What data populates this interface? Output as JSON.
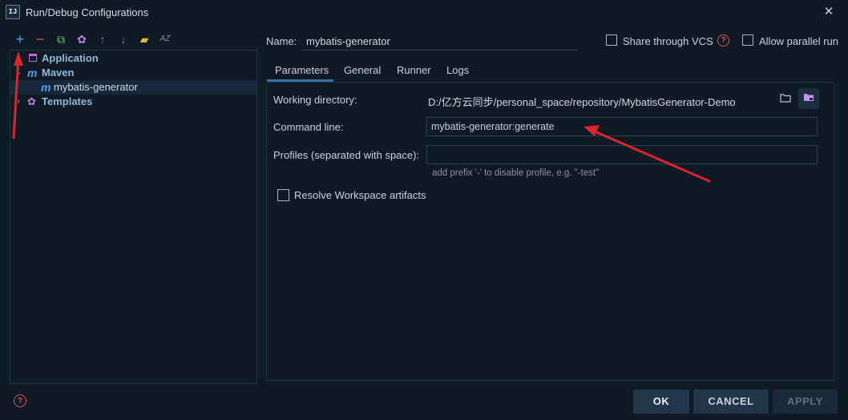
{
  "window": {
    "icon_text": "IJ",
    "title": "Run/Debug Configurations",
    "close_glyph": "✕"
  },
  "toolbar": {
    "icons": [
      "add-icon",
      "remove-icon",
      "copy-icon",
      "settings-icon",
      "move-up-icon",
      "move-down-icon",
      "new-folder-icon",
      "sort-alphabetically-icon"
    ],
    "add_glyph": "+",
    "remove_glyph": "−",
    "copy_glyph": "⧉",
    "settings_glyph": "✿",
    "up_glyph": "↑",
    "down_glyph": "↓",
    "folder_glyph": "▰",
    "sort_glyph": "AZ"
  },
  "tree": {
    "items": [
      {
        "label": "Application",
        "icon": "application-icon",
        "expanded": false
      },
      {
        "label": "Maven",
        "icon": "maven-icon",
        "expanded": true
      },
      {
        "label": "mybatis-generator",
        "icon": "maven-icon",
        "selected": true
      },
      {
        "label": "Templates",
        "icon": "wrench-icon",
        "expanded": false
      }
    ],
    "maven_glyph": "m"
  },
  "name_row": {
    "label": "Name:",
    "value": "mybatis-generator",
    "share_label": "Share through VCS",
    "share_checked": false,
    "help_glyph": "?",
    "parallel_label": "Allow parallel run",
    "parallel_checked": false
  },
  "tabs": [
    {
      "label": "Parameters",
      "active": true
    },
    {
      "label": "General"
    },
    {
      "label": "Runner"
    },
    {
      "label": "Logs"
    }
  ],
  "params": {
    "working_dir_label": "Working directory:",
    "working_dir_value": "D:/亿方云同步/personal_space/repository/MybatisGenerator-Demo",
    "command_line_label": "Command line:",
    "command_line_value": "mybatis-generator:generate",
    "profiles_label": "Profiles (separated with space):",
    "profiles_value": "",
    "profiles_hint": "add prefix '-' to disable profile, e.g. \"-test\"",
    "resolve_label": "Resolve Workspace artifacts",
    "resolve_checked": false,
    "folder_glyph": "📂",
    "macro_glyph": "▣"
  },
  "buttons": {
    "ok": "OK",
    "cancel": "CANCEL",
    "apply": "APPLY",
    "help_glyph": "?"
  },
  "colors": {
    "background": "#0f1a24",
    "accent": "#3a6fa8",
    "annotation_arrow": "#d8262d",
    "help_icon": "#e0505a"
  }
}
